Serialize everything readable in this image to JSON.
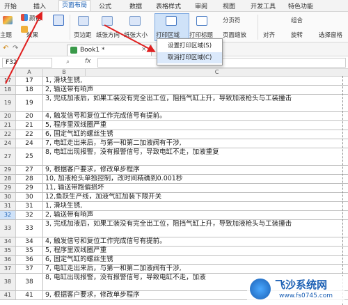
{
  "menubar": {
    "items": [
      "开始",
      "插入",
      "页面布局",
      "公式",
      "数据",
      "表格样式",
      "审阅",
      "视图",
      "开发工具",
      "特色功能"
    ],
    "active_index": 2
  },
  "ribbon": {
    "theme_label": "主题",
    "colors_label": "颜色",
    "effects_label": "效果",
    "margins_label": "页边距",
    "orientation_label": "纸张方向",
    "size_label": "纸张大小",
    "print_area_label": "打印区域",
    "print_titles_label": "打印标题",
    "page_break_label": "分页符",
    "page_zoom_label": "页面缩放",
    "align_label": "对齐",
    "group_label": "组合",
    "rotate_label": "旋转",
    "selection_pane_label": "选择窗格"
  },
  "toolbar": {
    "doc_tab_label": "Book1 *"
  },
  "formula_bar": {
    "cell_ref": "F32",
    "fx_label": "fx"
  },
  "dropdown": {
    "set_print_area": "设置打印区域(S)",
    "cancel_print_area": "取消打印区域(C)"
  },
  "grid": {
    "columns": [
      "A",
      "B",
      "C"
    ],
    "rows": [
      {
        "n": "17",
        "a": "17",
        "b": "1, 滑块生锈,"
      },
      {
        "n": "18",
        "a": "18",
        "b": "2, 输送带有响声"
      },
      {
        "n": "19",
        "a": "19",
        "b": "3, 完成加液后，如果工装没有完全出工位，阻挡气缸上升，导致加液枪头与工装撞击",
        "tall": true
      },
      {
        "n": "20",
        "a": "20",
        "b": "4, 触发信号和复位工作完成信号有提前。"
      },
      {
        "n": "21",
        "a": "21",
        "b": "5, 程序里双线圈严重"
      },
      {
        "n": "22",
        "a": "22",
        "b": "6, 固定气缸的螺丝生锈"
      },
      {
        "n": "24",
        "a": "24",
        "b": "7, 电缸走出来后，与第一和第二加液阀有干涉,"
      },
      {
        "n": "27",
        "a": "25",
        "b": "8, 电缸出现报警，没有报警信号，导致电缸不走，加液重复",
        "tall": true
      },
      {
        "n": "29",
        "a": "27",
        "b": "9, 根据客户要求，修改单步程序"
      },
      {
        "n": "28",
        "a": "28",
        "b": "10, 加液枪头单独控制，改时间精确到0.001秒"
      },
      {
        "n": "29",
        "a": "29",
        "b": "11, 输送带跑偏损坏"
      },
      {
        "n": "30",
        "a": "30",
        "b": "12,鱼跃生产线，加液气缸加装下限开关"
      },
      {
        "n": "31",
        "a": "31",
        "b": "1, 滑块生锈,"
      },
      {
        "n": "32",
        "a": "32",
        "b": "2, 输送带有响声",
        "sel": true
      },
      {
        "n": "33",
        "a": "33",
        "b": "3, 完成加液后，如果工装没有完全出工位，阻挡气缸上升，导致加液枪头与工装撞击",
        "tall": true
      },
      {
        "n": "34",
        "a": "34",
        "b": "4, 触发信号和复位工作完成信号有提前。"
      },
      {
        "n": "35",
        "a": "35",
        "b": "5, 程序里双线圈严重"
      },
      {
        "n": "36",
        "a": "36",
        "b": "6, 固定气缸的螺丝生锈"
      },
      {
        "n": "37",
        "a": "37",
        "b": "7, 电缸走出来后，与第一和第二加液阀有干涉,"
      },
      {
        "n": "38",
        "a": "38",
        "b": "8, 电缸出现报警，没有报警信号，导致电缸不走，加液",
        "tall": true
      },
      {
        "n": "41",
        "a": "41",
        "b": "9, 根据客户要求，修改单步程序"
      }
    ]
  },
  "watermark": {
    "text": "飞沙系统网",
    "url": "www.fs0745.com"
  }
}
